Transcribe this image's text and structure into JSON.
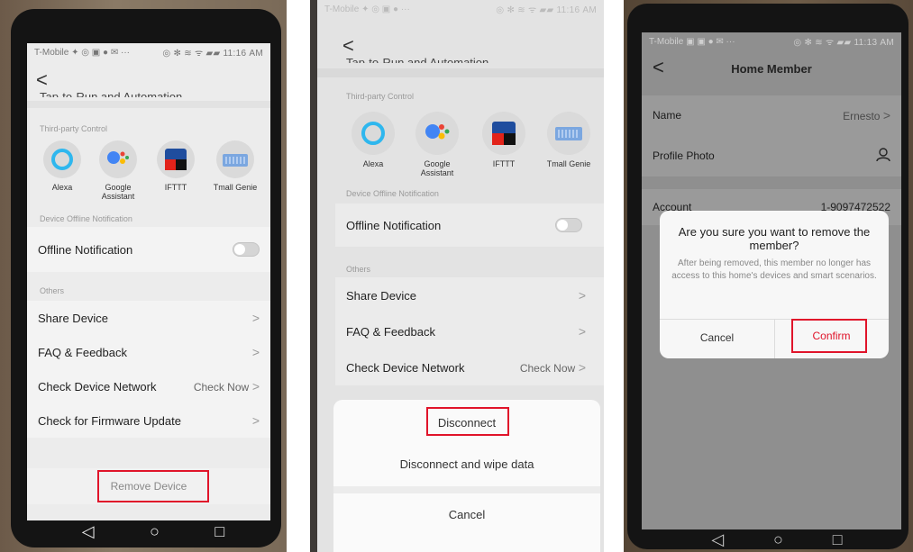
{
  "panel1": {
    "status_left": "T-Mobile ✦ ◎ ▣ ● ✉ ···",
    "status_right": "◎ ✻ ≋ ᯤ ▰▰ 11:16 AM",
    "back": "<",
    "cut_title": "Tap-to-Run and Automation",
    "third_party_label": "Third-party Control",
    "third_party": [
      "Alexa",
      "Google Assistant",
      "IFTTT",
      "Tmall Genie"
    ],
    "offline_label": "Device Offline Notification",
    "offline_row": "Offline Notification",
    "others_label": "Others",
    "rows": [
      "Share Device",
      "FAQ & Feedback",
      "Check Device Network",
      "Check for Firmware Update"
    ],
    "check_now": "Check Now",
    "chevron": ">",
    "remove_device": "Remove Device",
    "nav": [
      "◁",
      "○",
      "□"
    ]
  },
  "panel2": {
    "status_left": "T-Mobile ✦ ◎ ▣ ● ···",
    "status_right": "◎ ✻ ≋ ᯤ ▰▰ 11:16 AM",
    "back": "<",
    "cut_title": "Tap-to-Run and Automation",
    "third_party_label": "Third-party Control",
    "third_party": [
      "Alexa",
      "Google Assistant",
      "IFTTT",
      "Tmall Genie"
    ],
    "offline_label": "Device Offline Notification",
    "offline_row": "Offline Notification",
    "others_label": "Others",
    "rows": [
      "Share Device",
      "FAQ & Feedback",
      "Check Device Network"
    ],
    "check_now": "Check Now",
    "chevron": ">",
    "sheet": {
      "disconnect": "Disconnect",
      "disconnect_wipe": "Disconnect and wipe data",
      "cancel": "Cancel"
    }
  },
  "panel3": {
    "status_left": "T-Mobile ▣ ▣ ● ✉ ···",
    "status_right": "◎ ✻ ≋ ᯤ ▰▰ 11:13 AM",
    "back": "<",
    "title": "Home Member",
    "name_label": "Name",
    "name_value": "Ernesto",
    "chevron": ">",
    "photo_label": "Profile Photo",
    "account_label": "Account",
    "account_value": "1-9097472522",
    "dialog": {
      "title": "Are you sure you want to remove the member?",
      "message": "After being removed, this member no longer has access to this home's devices and smart scenarios.",
      "cancel": "Cancel",
      "confirm": "Confirm"
    },
    "nav": [
      "◁",
      "○",
      "□"
    ]
  },
  "colors": {
    "highlight": "#e0142a",
    "confirm_text": "#e0142a",
    "alexa": "#2fb7ee",
    "google_blue": "#4285f4",
    "google_red": "#ea4335",
    "google_yellow": "#fbbc05",
    "google_green": "#34a853",
    "ifttt_blue": "#1f4d9e",
    "ifttt_red": "#e2231a",
    "tmall": "#7ba7e0"
  }
}
